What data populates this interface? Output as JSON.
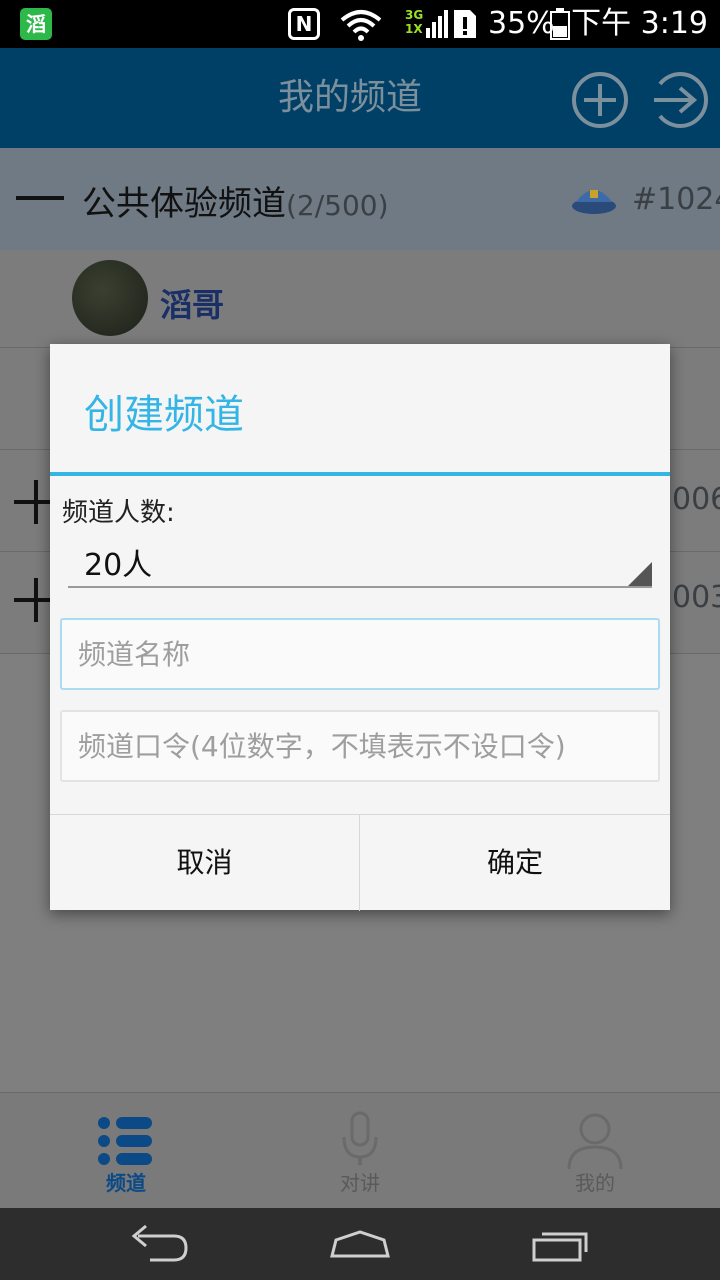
{
  "status_bar": {
    "app_icon_char": "滔",
    "network_type": "3G\n1X",
    "battery_percent": "35%",
    "time": "下午 3:19"
  },
  "app_bar": {
    "title": "我的频道",
    "add_icon": "plus-circle-icon",
    "exit_icon": "login-arrow-icon"
  },
  "channel_list": {
    "group": {
      "name": "公共体验频道",
      "count": "(2/500)",
      "id": "#1024"
    },
    "member": {
      "name": "滔哥"
    },
    "rows": [
      {
        "id": "006"
      },
      {
        "id": "003"
      }
    ]
  },
  "dialog": {
    "title": "创建频道",
    "size_label": "频道人数:",
    "size_value": "20人",
    "name_placeholder": "频道名称",
    "password_placeholder": "频道口令(4位数字，不填表示不设口令)",
    "cancel_label": "取消",
    "ok_label": "确定"
  },
  "tabs": [
    {
      "label": "频道",
      "icon": "list-icon",
      "active": true
    },
    {
      "label": "对讲",
      "icon": "microphone-icon",
      "active": false
    },
    {
      "label": "我的",
      "icon": "person-icon",
      "active": false
    }
  ],
  "colors": {
    "accent": "#33b5e5",
    "app_bar": "#004066",
    "active_tab": "#0b4a86"
  }
}
